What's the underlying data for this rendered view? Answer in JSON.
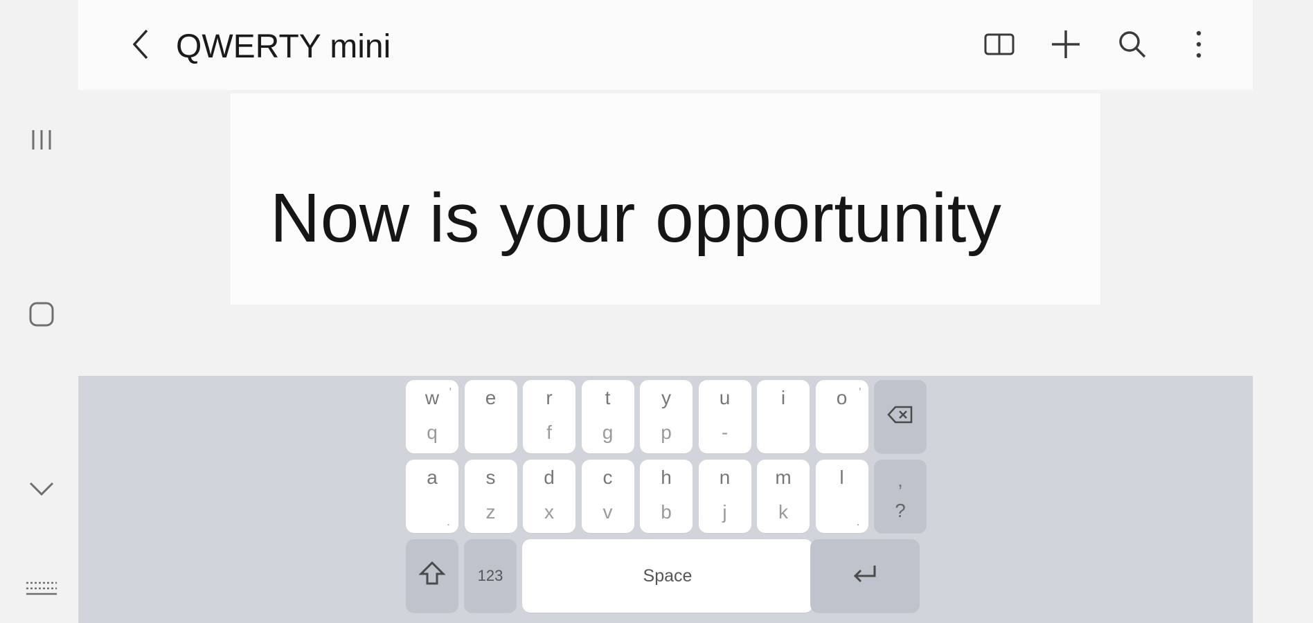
{
  "appbar": {
    "title": "QWERTY mini"
  },
  "icons": {
    "back": "chevron-left-icon",
    "split": "split-view-icon",
    "add": "plus-icon",
    "search": "search-icon",
    "more": "more-vertical-icon",
    "rail_recents": "recents-icon",
    "rail_home": "home-icon",
    "rail_back": "chevron-down-icon",
    "rail_keyboard": "keyboard-icon"
  },
  "preview": {
    "text": "Now is your opportunity"
  },
  "keyboard": {
    "row1": [
      {
        "top": "w",
        "bottom": "q",
        "mark": "'"
      },
      {
        "top": "e",
        "bottom": "",
        "mark": ""
      },
      {
        "top": "r",
        "bottom": "f",
        "mark": ""
      },
      {
        "top": "t",
        "bottom": "g",
        "mark": ""
      },
      {
        "top": "y",
        "bottom": "p",
        "mark": ""
      },
      {
        "top": "u",
        "bottom": "-",
        "mark": ""
      },
      {
        "top": "i",
        "bottom": "",
        "mark": ""
      },
      {
        "top": "o",
        "bottom": "",
        "mark": "'"
      }
    ],
    "row2": [
      {
        "top": "a",
        "bottom": "",
        "mark": "."
      },
      {
        "top": "s",
        "bottom": "z",
        "mark": ""
      },
      {
        "top": "d",
        "bottom": "x",
        "mark": ""
      },
      {
        "top": "c",
        "bottom": "v",
        "mark": ""
      },
      {
        "top": "h",
        "bottom": "b",
        "mark": ""
      },
      {
        "top": "n",
        "bottom": "j",
        "mark": ""
      },
      {
        "top": "m",
        "bottom": "k",
        "mark": ""
      },
      {
        "top": "l",
        "bottom": "",
        "mark": "."
      }
    ],
    "punct_top": ",",
    "punct_bottom": "?",
    "numbers_label": "123",
    "space_label": "Space"
  },
  "colors": {
    "background": "#f2f2f2",
    "appbar": "#fbfbfb",
    "keyboard": "#d1d4db",
    "key": "#ffffff",
    "func_key": "#bfc3cc"
  }
}
